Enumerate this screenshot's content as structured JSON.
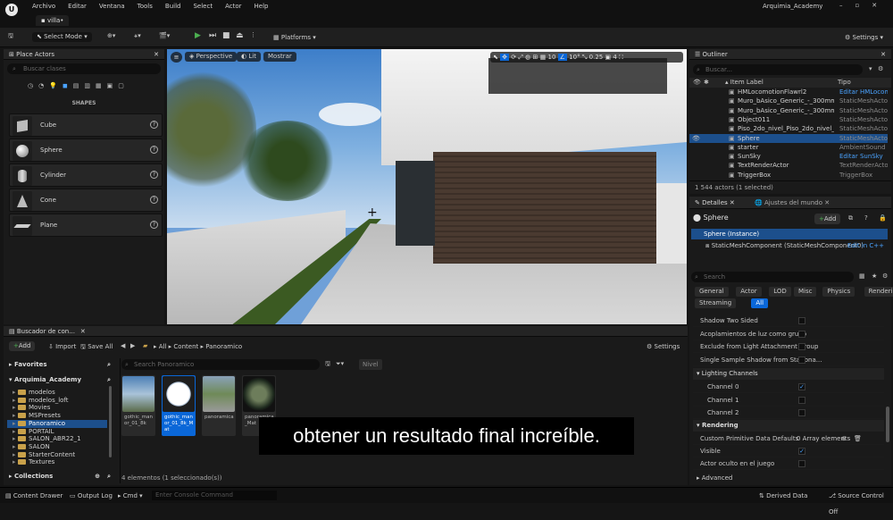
{
  "menu": {
    "items": [
      "Archivo",
      "Editar",
      "Ventana",
      "Tools",
      "Build",
      "Select",
      "Actor",
      "Help"
    ],
    "project_tab": "villa•",
    "project_name": "Arquimia_Academy"
  },
  "toolbar": {
    "select_mode": "Select Mode",
    "platforms": "Platforms",
    "settings": "Settings"
  },
  "place_actors": {
    "title": "Place Actors",
    "search_placeholder": "Buscar clases",
    "section": "SHAPES",
    "items": [
      "Cube",
      "Sphere",
      "Cylinder",
      "Cone",
      "Plane"
    ]
  },
  "viewport": {
    "perspective": "Perspective",
    "lit": "Lit",
    "show": "Mostrar",
    "grid": "10",
    "angle": "10°",
    "scale": "0.25",
    "cam": "4"
  },
  "outliner": {
    "title": "Outliner",
    "search_placeholder": "Buscar...",
    "col_label": "Item Label",
    "col_type": "Tipo",
    "rows": [
      {
        "name": "HMLocomotionFlawrl2",
        "type": "Editar HMLocom",
        "link": true
      },
      {
        "name": "Muro_bAsico_Generic_-_300mm__20",
        "type": "StaticMeshActor",
        "link": false
      },
      {
        "name": "Muro_bAsico_Generic_-_300mm__20",
        "type": "StaticMeshActor",
        "link": false
      },
      {
        "name": "Object011",
        "type": "StaticMeshActor",
        "link": false
      },
      {
        "name": "Piso_2do_nivel_Piso_2do_nivel__2025",
        "type": "StaticMeshActor",
        "link": false
      },
      {
        "name": "Sphere",
        "type": "StaticMeshActor",
        "link": false
      },
      {
        "name": "starter",
        "type": "AmbientSound",
        "link": false
      },
      {
        "name": "SunSky",
        "type": "Editar SunSky",
        "link": true
      },
      {
        "name": "TextRenderActor",
        "type": "TextRenderActor",
        "link": false
      },
      {
        "name": "TriggerBox",
        "type": "TriggerBox",
        "link": false
      }
    ],
    "status": "1 544 actors (1 selected)"
  },
  "details": {
    "tab1": "Detalles",
    "tab2": "Ajustes del mundo",
    "object": "Sphere",
    "add": "Add",
    "instance": "Sphere (Instance)",
    "component": "StaticMeshComponent (StaticMeshComponent0)",
    "edit_cpp": "Edit in C++",
    "search_placeholder": "Search",
    "filters_row1": [
      "General",
      "Actor",
      "LOD",
      "Misc",
      "Physics",
      "Rendering"
    ],
    "filters_row2": [
      "Streaming",
      "All"
    ],
    "props": [
      {
        "name": "Shadow Two Sided",
        "checked": false,
        "indent": 0
      },
      {
        "name": "Acoplamientos de luz como grupo",
        "checked": false,
        "indent": 0
      },
      {
        "name": "Exclude from Light Attachment Group",
        "checked": false,
        "indent": 0
      },
      {
        "name": "Single Sample Shadow from Stationa...",
        "checked": false,
        "indent": 0
      }
    ],
    "lighting_channels": "Lighting Channels",
    "channels": [
      {
        "name": "Channel 0",
        "checked": true
      },
      {
        "name": "Channel 1",
        "checked": false
      },
      {
        "name": "Channel 2",
        "checked": false
      }
    ],
    "rendering": "Rendering",
    "custom_prim": "Custom Primitive Data Defaults",
    "array_elems": "0 Array elements",
    "visible": "Visible",
    "hidden_game": "Actor oculto en el juego",
    "advanced": "Advanced"
  },
  "content": {
    "tab": "Buscador de con...",
    "add": "Add",
    "import": "Import",
    "save_all": "Save All",
    "path": [
      "All",
      "Content",
      "Panoramico"
    ],
    "settings": "Settings",
    "favorites": "Favorites",
    "project": "Arquimia_Academy",
    "folders": [
      "modelos",
      "modelos_loft",
      "Movies",
      "MSPresets",
      "Panoramico",
      "PORTAIL",
      "SALON_ABR22_1",
      "SALON",
      "StarterContent",
      "Textures"
    ],
    "search_placeholder": "Search Panoramico",
    "nivel": "Nivel",
    "assets": [
      {
        "name": "gothic_manor_01_8k",
        "color": "#6d8fae"
      },
      {
        "name": "gothic_manor_01_8k_Mat",
        "color": "#e9eef4"
      },
      {
        "name": "panoramica",
        "color": "#7b8a6a"
      },
      {
        "name": "panoramica_Mat",
        "color": "#3b4a3a"
      }
    ],
    "count": "4 elementos (1 seleccionado(s))",
    "collections": "Collections"
  },
  "subtitle": "obtener un resultado final increíble.",
  "statusbar": {
    "drawer": "Content Drawer",
    "output": "Output Log",
    "cmd": "Cmd",
    "console_placeholder": "Enter Console Command",
    "derived": "Derived Data",
    "source": "Source Control Off"
  },
  "colors": {
    "accent": "#0a67d8",
    "selected": "#1c4f8c",
    "link": "#4aa3ff",
    "folder": "#c9a14a"
  }
}
